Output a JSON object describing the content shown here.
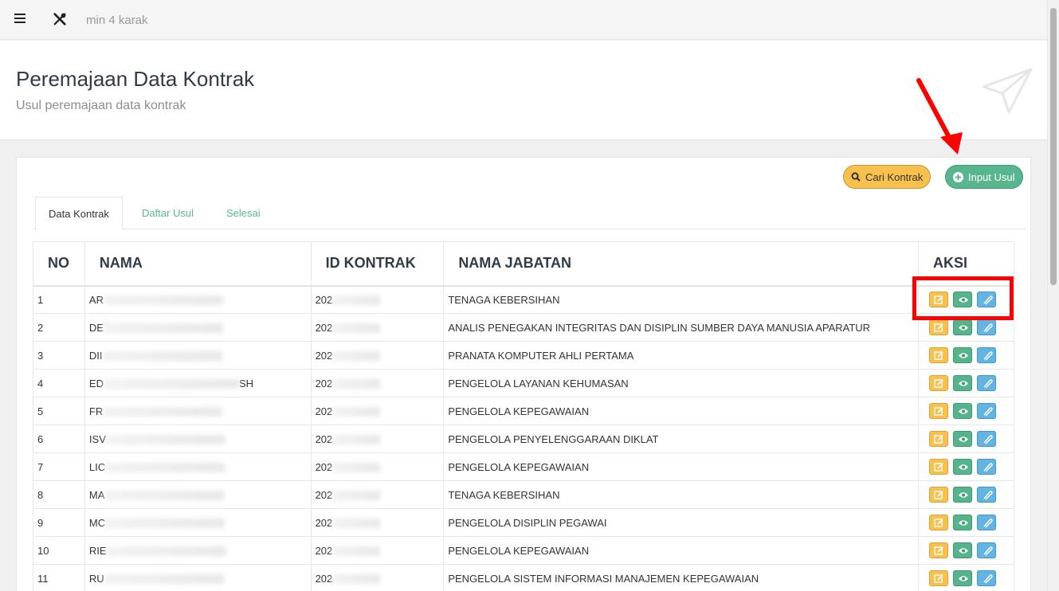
{
  "topbar": {
    "search_placeholder": "min 4 karak",
    "icons": [
      "hamburger-icon",
      "tools-icon"
    ]
  },
  "header": {
    "title": "Peremajaan Data Kontrak",
    "subtitle": "Usul peremajaan data kontrak",
    "icon": "paper-plane-icon"
  },
  "toolbar": {
    "cari_label": "Cari Kontrak",
    "input_label": "Input Usul"
  },
  "tabs": [
    {
      "label": "Data Kontrak",
      "active": true
    },
    {
      "label": "Daftar Usul",
      "active": false
    },
    {
      "label": "Selesai",
      "active": false
    }
  ],
  "table": {
    "headers": [
      "NO",
      "NAMA",
      "ID KONTRAK",
      "NAMA JABATAN",
      "AKSI"
    ],
    "rows": [
      {
        "no": "1",
        "nama": "AR",
        "id": "202",
        "jabatan": "TENAGA KEBERSIHAN"
      },
      {
        "no": "2",
        "nama": "DE",
        "id": "202",
        "jabatan": "ANALIS PENEGAKAN INTEGRITAS DAN DISIPLIN SUMBER DAYA MANUSIA APARATUR"
      },
      {
        "no": "3",
        "nama": "DII",
        "id": "202",
        "jabatan": "PRANATA KOMPUTER AHLI PERTAMA"
      },
      {
        "no": "4",
        "nama": "ED",
        "nama_tail": "SH",
        "id": "202",
        "jabatan": "PENGELOLA LAYANAN KEHUMASAN"
      },
      {
        "no": "5",
        "nama": "FR",
        "id": "202",
        "jabatan": "PENGELOLA KEPEGAWAIAN"
      },
      {
        "no": "6",
        "nama": "ISV",
        "id": "202",
        "jabatan": "PENGELOLA PENYELENGGARAAN DIKLAT"
      },
      {
        "no": "7",
        "nama": "LIC",
        "id": "202",
        "jabatan": "PENGELOLA KEPEGAWAIAN"
      },
      {
        "no": "8",
        "nama": "MA",
        "id": "202",
        "jabatan": "TENAGA KEBERSIHAN"
      },
      {
        "no": "9",
        "nama": "MC",
        "id": "202",
        "jabatan": "PENGELOLA DISIPLIN PEGAWAI"
      },
      {
        "no": "10",
        "nama": "RIE",
        "id": "202",
        "jabatan": "PENGELOLA KEPEGAWAIAN"
      },
      {
        "no": "11",
        "nama": "RU",
        "id": "202",
        "jabatan": "PENGELOLA SISTEM INFORMASI MANAJEMEN KEPEGAWAIAN"
      }
    ],
    "action_icons": [
      "edit-icon",
      "eye-icon",
      "paperclip-icon"
    ]
  },
  "colors": {
    "accent_green": "#58b68f",
    "accent_yellow": "#f8c14d",
    "accent_blue": "#63b3e3",
    "annotation_red": "#ff0000"
  }
}
